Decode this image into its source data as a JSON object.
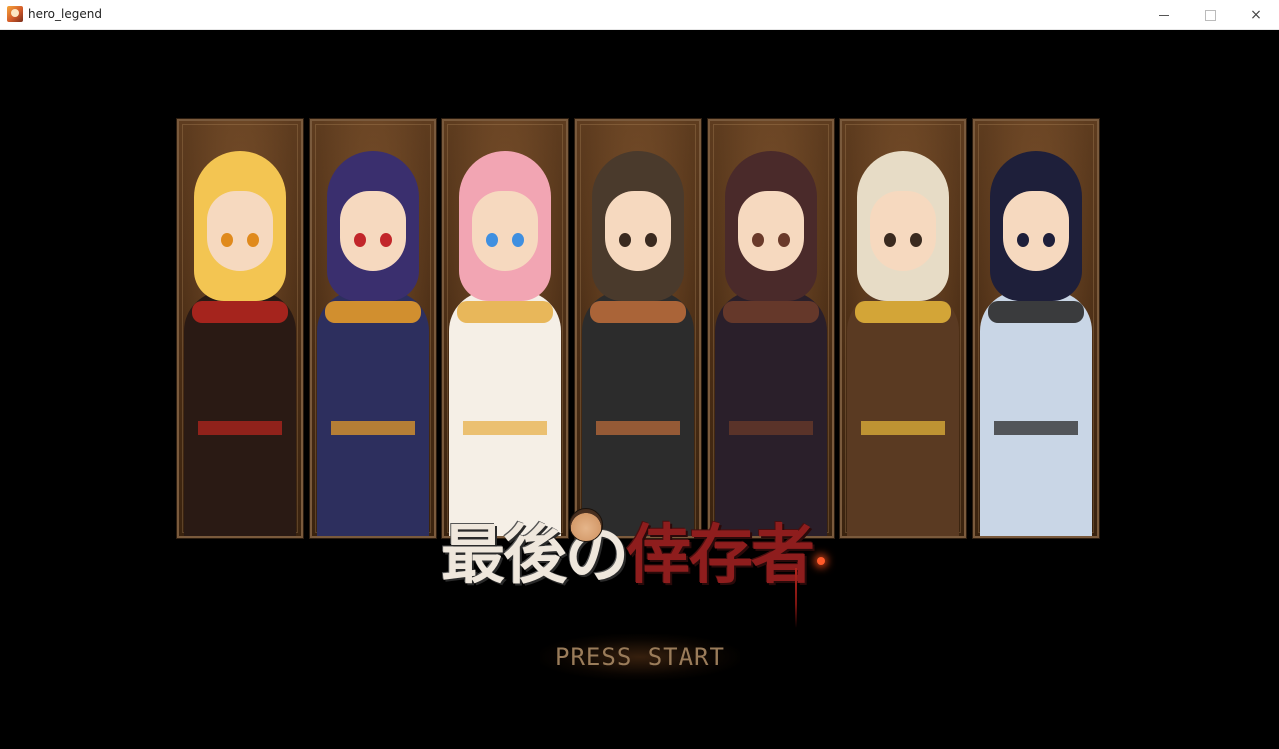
{
  "window": {
    "title": "hero_legend",
    "controls": {
      "minimize": "minimize",
      "maximize": "maximize",
      "close": "×"
    }
  },
  "game": {
    "logo": {
      "part1": "最後の",
      "part2": "倖存者"
    },
    "press_start": "PRESS START",
    "characters": [
      {
        "id": "blonde-horned-girl",
        "hair": "#f3c552",
        "eyes": "#e08a1c",
        "outfit": "#2a1a14",
        "accent": "#b3261e"
      },
      {
        "id": "oni-mask-kunoichi",
        "hair": "#3a2f6e",
        "eyes": "#c2262a",
        "outfit": "#2d2f5e",
        "accent": "#e39a2a"
      },
      {
        "id": "pink-maid",
        "hair": "#f2a5b3",
        "eyes": "#3f8fe0",
        "outfit": "#f5efe6",
        "accent": "#e7b04a"
      },
      {
        "id": "blacksmith-man",
        "hair": "#4a3a2c",
        "eyes": "#3a2a1f",
        "outfit": "#2c2c2c",
        "accent": "#b86a3a"
      },
      {
        "id": "glasses-woman",
        "hair": "#4a2a2a",
        "eyes": "#6a3a2a",
        "outfit": "#2a1f2a",
        "accent": "#6b3b2a"
      },
      {
        "id": "old-warrior",
        "hair": "#e7dcc6",
        "eyes": "#3a2a1f",
        "outfit": "#5a3a22",
        "accent": "#e0b13a"
      },
      {
        "id": "samurai",
        "hair": "#1e1f3a",
        "eyes": "#1e1f3a",
        "outfit": "#c9d6e6",
        "accent": "#2a2a2a"
      }
    ]
  }
}
